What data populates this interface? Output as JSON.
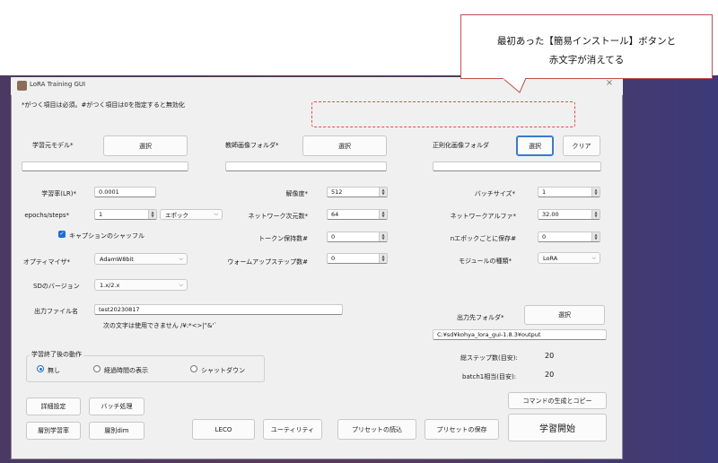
{
  "annotation": {
    "callout_line1": "最初あった【簡易インストール】ボタンと",
    "callout_line2": "赤文字が消えてる"
  },
  "window": {
    "title": "LoRA Training GUI",
    "close_glyph": "×"
  },
  "notice": "*がつく項目は必須。#がつく項目は0を指定すると無効化",
  "model_row": {
    "base_model_label": "学習元モデル*",
    "base_model_button": "選択",
    "base_model_path": "",
    "teacher_folder_label": "教師画像フォルダ*",
    "teacher_folder_button": "選択",
    "teacher_folder_path": "",
    "reg_folder_label": "正則化画像フォルダ",
    "reg_folder_button": "選択",
    "reg_clear_button": "クリア",
    "reg_folder_path": ""
  },
  "params": {
    "lr_label": "学習率(LR)*",
    "lr_value": "0.0001",
    "resolution_label": "解像度*",
    "resolution_value": "512",
    "batch_label": "バッチサイズ*",
    "batch_value": "1",
    "epochs_label": "epochs/steps*",
    "epochs_value": "1",
    "epochs_unit": "エポック",
    "net_dim_label": "ネットワーク次元数*",
    "net_dim_value": "64",
    "net_alpha_label": "ネットワークアルファ*",
    "net_alpha_value": "32.00",
    "shuffle_caption_label": "キャプションのシャッフル",
    "shuffle_caption_checked": true,
    "keep_tokens_label": "トークン保持数#",
    "keep_tokens_value": "0",
    "save_every_label": "nエポックごとに保存#",
    "save_every_value": "0",
    "optimizer_label": "オプティマイザ*",
    "optimizer_value": "AdamW8bit",
    "warmup_label": "ウォームアップステップ数#",
    "warmup_value": "0",
    "module_label": "モジュールの種類*",
    "module_value": "LoRA",
    "sd_version_label": "SDのバージョン",
    "sd_version_value": "1.x/2.x"
  },
  "output": {
    "filename_label": "出力ファイル名",
    "filename_value": "test20230817",
    "filename_hint": "次の文字は使用できません /¥:*<>|\"&'`",
    "folder_label": "出力先フォルダ*",
    "folder_button": "選択",
    "folder_path": "C:¥sd¥kohya_lora_gui-1.8.3¥output"
  },
  "after_training": {
    "group_label": "学習終了後の動作",
    "option_none": "無し",
    "option_elapsed": "経過時間の表示",
    "option_shutdown": "シャットダウン",
    "selected": "無し"
  },
  "stats": {
    "total_steps_label": "総ステップ数(目安):",
    "total_steps_value": "20",
    "batch1_label": "batch1相当(目安):",
    "batch1_value": "20"
  },
  "buttons": {
    "detail_settings": "詳細設定",
    "batch_process": "バッチ処理",
    "layer_lr": "層別学習率",
    "layer_dim": "層別dim",
    "leco": "LECO",
    "utility": "ユーティリティ",
    "load_preset": "プリセットの読込",
    "save_preset": "プリセットの保存",
    "generate_command": "コマンドの生成とコピー",
    "start_training": "学習開始"
  },
  "colors": {
    "accent": "#1e6ed6",
    "annotation_red": "#e0504a"
  }
}
